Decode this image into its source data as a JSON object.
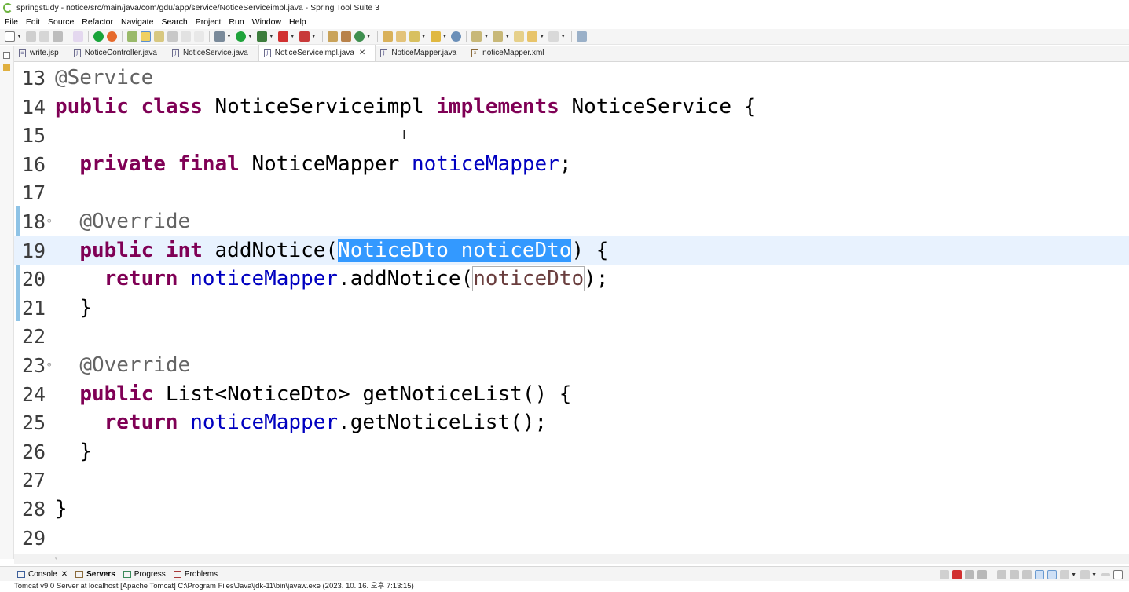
{
  "window": {
    "title": "springstudy - notice/src/main/java/com/gdu/app/service/NoticeServiceimpl.java - Spring Tool Suite 3"
  },
  "menu": [
    "File",
    "Edit",
    "Source",
    "Refactor",
    "Navigate",
    "Search",
    "Project",
    "Run",
    "Window",
    "Help"
  ],
  "tabs": [
    {
      "label": "write.jsp",
      "icon": "jsp-file-icon",
      "active": false
    },
    {
      "label": "NoticeController.java",
      "icon": "java-file-icon",
      "active": false
    },
    {
      "label": "NoticeService.java",
      "icon": "java-file-icon",
      "active": false
    },
    {
      "label": "NoticeServiceimpl.java",
      "icon": "java-file-icon",
      "active": true
    },
    {
      "label": "NoticeMapper.java",
      "icon": "java-file-icon",
      "active": false
    },
    {
      "label": "noticeMapper.xml",
      "icon": "xml-file-icon",
      "active": false
    }
  ],
  "editor": {
    "lines": [
      {
        "num": "13",
        "segs": [
          [
            "ann",
            "@Service"
          ]
        ]
      },
      {
        "num": "14",
        "segs": [
          [
            "kw",
            "public"
          ],
          [
            "",
            " "
          ],
          [
            "kw",
            "class"
          ],
          [
            "",
            " NoticeServiceimpl "
          ],
          [
            "kw",
            "implements"
          ],
          [
            "",
            " NoticeService {"
          ]
        ]
      },
      {
        "num": "15",
        "segs": []
      },
      {
        "num": "16",
        "segs": [
          [
            "",
            "  "
          ],
          [
            "kw",
            "private"
          ],
          [
            "",
            " "
          ],
          [
            "kw",
            "final"
          ],
          [
            "",
            " NoticeMapper "
          ],
          [
            "fld",
            "noticeMapper"
          ],
          [
            "",
            ";"
          ]
        ]
      },
      {
        "num": "17",
        "segs": []
      },
      {
        "num": "18",
        "fold": "⊖",
        "segs": [
          [
            "",
            "  "
          ],
          [
            "ann",
            "@Override"
          ]
        ]
      },
      {
        "num": "19",
        "current": true,
        "segs": [
          [
            "",
            "  "
          ],
          [
            "kw",
            "public"
          ],
          [
            "",
            " "
          ],
          [
            "kw",
            "int"
          ],
          [
            "",
            " addNotice("
          ],
          [
            "sel",
            "NoticeDto noticeDto"
          ],
          [
            "",
            ") {"
          ]
        ]
      },
      {
        "num": "20",
        "segs": [
          [
            "",
            "    "
          ],
          [
            "kw",
            "return"
          ],
          [
            "",
            " "
          ],
          [
            "fld",
            "noticeMapper"
          ],
          [
            "",
            ".addNotice("
          ],
          [
            "prm box",
            "noticeDto"
          ],
          [
            "",
            ");"
          ]
        ]
      },
      {
        "num": "21",
        "segs": [
          [
            "",
            "  }"
          ]
        ]
      },
      {
        "num": "22",
        "segs": []
      },
      {
        "num": "23",
        "fold": "⊖",
        "segs": [
          [
            "",
            "  "
          ],
          [
            "ann",
            "@Override"
          ]
        ]
      },
      {
        "num": "24",
        "segs": [
          [
            "",
            "  "
          ],
          [
            "kw",
            "public"
          ],
          [
            "",
            " List<NoticeDto> getNoticeList() {"
          ]
        ]
      },
      {
        "num": "25",
        "segs": [
          [
            "",
            "    "
          ],
          [
            "kw",
            "return"
          ],
          [
            "",
            " "
          ],
          [
            "fld",
            "noticeMapper"
          ],
          [
            "",
            ".getNoticeList();"
          ]
        ]
      },
      {
        "num": "26",
        "segs": [
          [
            "",
            "  }"
          ]
        ]
      },
      {
        "num": "27",
        "segs": []
      },
      {
        "num": "28",
        "segs": [
          [
            "",
            "}"
          ]
        ]
      },
      {
        "num": "29",
        "segs": []
      }
    ]
  },
  "bottom_panel": {
    "tabs": [
      {
        "label": "Console",
        "closable": true,
        "active": false
      },
      {
        "label": "Servers",
        "closable": false,
        "active": true
      },
      {
        "label": "Progress",
        "closable": false,
        "active": false
      },
      {
        "label": "Problems",
        "closable": false,
        "active": false
      }
    ]
  },
  "status": {
    "text": "Tomcat v9.0 Server at localhost [Apache Tomcat] C:\\Program Files\\Java\\jdk-11\\bin\\javaw.exe  (2023. 10. 16. 오후 7:13:15)"
  },
  "colors": {
    "keyword": "#7f0055",
    "annotation": "#646464",
    "field": "#0000c0",
    "parameter": "#6a3e3e",
    "selection": "#3399ff",
    "current_line": "#e8f2fe"
  }
}
